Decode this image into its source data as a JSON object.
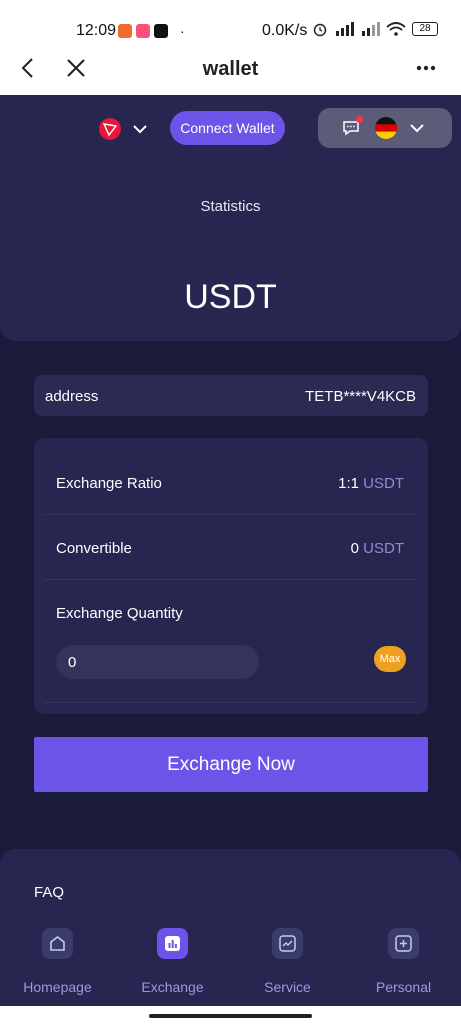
{
  "status_bar": {
    "time": "12:09",
    "network_speed": "0.0K/s",
    "battery": "28"
  },
  "nav": {
    "title": "wallet"
  },
  "header": {
    "connect_label": "Connect Wallet",
    "statistics_label": "Statistics",
    "token": "USDT"
  },
  "address": {
    "label": "address",
    "value": "TETB****V4KCB"
  },
  "exchange": {
    "ratio_label": "Exchange Ratio",
    "ratio_value": "1:1",
    "ratio_unit": "USDT",
    "convertible_label": "Convertible",
    "convertible_value": "0",
    "convertible_unit": "USDT",
    "quantity_label": "Exchange Quantity",
    "quantity_value": "0",
    "max_label": "Max",
    "submit_label": "Exchange Now"
  },
  "faq": {
    "label": "FAQ"
  },
  "tabs": [
    {
      "label": "Homepage",
      "icon": "home-icon",
      "active": false
    },
    {
      "label": "Exchange",
      "icon": "chart-icon",
      "active": true
    },
    {
      "label": "Service",
      "icon": "trend-icon",
      "active": false
    },
    {
      "label": "Personal",
      "icon": "plus-square-icon",
      "active": false
    }
  ],
  "colors": {
    "background": "#1a1a3a",
    "panel": "#262650",
    "accent": "#6c54e8",
    "max_button": "#f0a020",
    "unit_text": "#8c8cd2",
    "tab_text": "#9a9ae0"
  }
}
